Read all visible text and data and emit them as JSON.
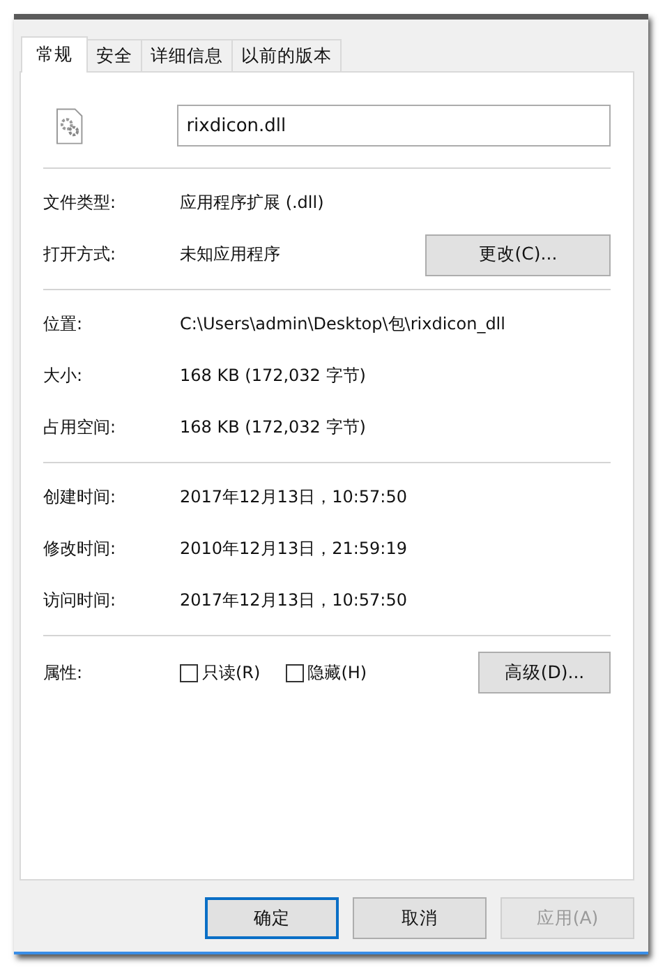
{
  "tabs": [
    {
      "label": "常规",
      "selected": true
    },
    {
      "label": "安全",
      "selected": false
    },
    {
      "label": "详细信息",
      "selected": false
    },
    {
      "label": "以前的版本",
      "selected": false
    }
  ],
  "file_name": {
    "value": "rixdicon.dll"
  },
  "groups": [
    {
      "rows": [
        {
          "label": "文件类型:",
          "value": "应用程序扩展 (.dll)"
        },
        {
          "label": "打开方式:",
          "value": "未知应用程序",
          "button": "更改(C)..."
        }
      ]
    },
    {
      "rows": [
        {
          "label": "位置:",
          "value": "C:\\Users\\admin\\Desktop\\包\\rixdicon_dll"
        },
        {
          "label": "大小:",
          "value": "168 KB (172,032 字节)"
        },
        {
          "label": "占用空间:",
          "value": "168 KB (172,032 字节)"
        }
      ]
    },
    {
      "rows": [
        {
          "label": "创建时间:",
          "value": "2017年12月13日，10:57:50"
        },
        {
          "label": "修改时间:",
          "value": "2010年12月13日，21:59:19"
        },
        {
          "label": "访问时间:",
          "value": "2017年12月13日，10:57:50"
        }
      ]
    }
  ],
  "attributes": {
    "label": "属性:",
    "checkboxes": [
      {
        "label": "只读(R)",
        "checked": false
      },
      {
        "label": "隐藏(H)",
        "checked": false
      }
    ],
    "button": "高级(D)..."
  },
  "buttons": [
    {
      "label": "确定",
      "default": true,
      "disabled": false
    },
    {
      "label": "取消",
      "default": false,
      "disabled": false
    },
    {
      "label": "应用(A)",
      "default": false,
      "disabled": true
    }
  ]
}
